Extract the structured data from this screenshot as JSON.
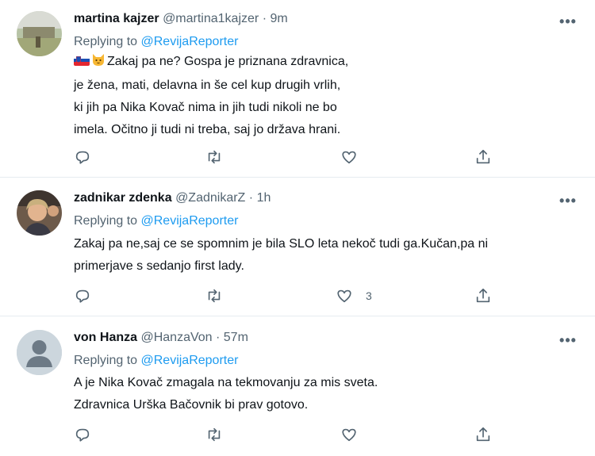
{
  "tweets": [
    {
      "display_name": "martina kajzer",
      "handle": "@martina1kajzer",
      "separator": "·",
      "time": "9m",
      "replying_label": "Replying to",
      "replying_handle": "@RevijaReporter",
      "emoji": [
        "slovenia-flag",
        "cat-face"
      ],
      "lines": [
        "Zakaj pa ne?  Gospa je priznana zdravnica,",
        "je žena, mati, delavna in še cel kup drugih vrlih,",
        "ki jih pa Nika Kovač nima in jih tudi nikoli ne bo",
        "imela. Očitno ji tudi ni treba, saj jo država hrani."
      ],
      "like_count": ""
    },
    {
      "display_name": "zadnikar zdenka",
      "handle": "@ZadnikarZ",
      "separator": "·",
      "time": "1h",
      "replying_label": "Replying to",
      "replying_handle": "@RevijaReporter",
      "lines": [
        "Zakaj pa ne,saj ce se spomnim je bila SLO leta nekoč tudi ga.Kučan,pa ni",
        "primerjave s sedanjo first lady."
      ],
      "like_count": "3"
    },
    {
      "display_name": "von Hanza",
      "handle": "@HanzaVon",
      "separator": "·",
      "time": "57m",
      "replying_label": "Replying to",
      "replying_handle": "@RevijaReporter",
      "lines": [
        "A je Nika Kovač zmagala na tekmovanju za mis sveta.",
        "Zdravnica  Urška Bačovnik bi prav gotovo."
      ],
      "like_count": ""
    }
  ],
  "more_glyph": "•••",
  "colors": {
    "link": "#1d9bf0",
    "muted": "#536471",
    "divider": "#e6ecf0"
  }
}
